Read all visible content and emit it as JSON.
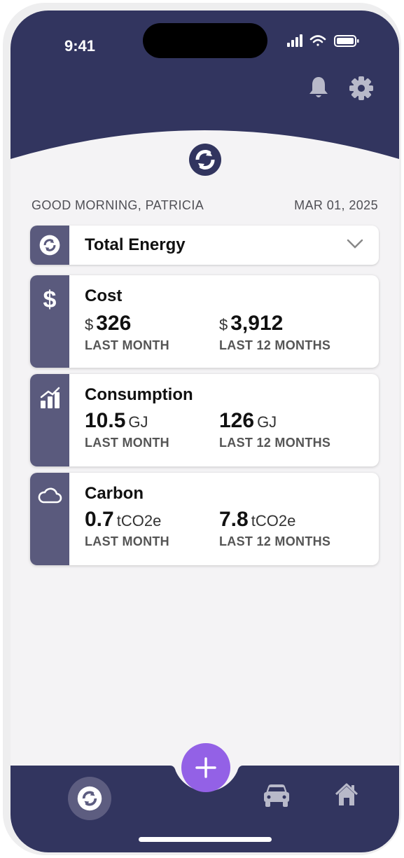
{
  "status_bar": {
    "time": "9:41"
  },
  "header": {
    "greeting": "GOOD MORNING, PATRICIA",
    "date": "MAR 01, 2025"
  },
  "selector": {
    "label": "Total Energy"
  },
  "cards": {
    "cost": {
      "title": "Cost",
      "last_month": {
        "prefix": "$",
        "value": "326",
        "caption": "LAST MONTH"
      },
      "last_12": {
        "prefix": "$",
        "value": "3,912",
        "caption": "LAST 12 MONTHS"
      }
    },
    "consumption": {
      "title": "Consumption",
      "last_month": {
        "value": "10.5",
        "unit": "GJ",
        "caption": "LAST MONTH"
      },
      "last_12": {
        "value": "126",
        "unit": "GJ",
        "caption": "LAST 12 MONTHS"
      }
    },
    "carbon": {
      "title": "Carbon",
      "last_month": {
        "value": "0.7",
        "unit": "tCO2e",
        "caption": "LAST MONTH"
      },
      "last_12": {
        "value": "7.8",
        "unit": "tCO2e",
        "caption": "LAST 12 MONTHS"
      }
    }
  },
  "icons": {
    "header": [
      "bell-icon",
      "gear-icon"
    ],
    "nav": [
      "energy-icon",
      "add-icon",
      "car-icon",
      "home-icon"
    ]
  },
  "colors": {
    "navy": "#32355f",
    "side_panel": "#5a5a7d",
    "accent": "#9361e6",
    "icon_muted": "#b8b9c9"
  }
}
